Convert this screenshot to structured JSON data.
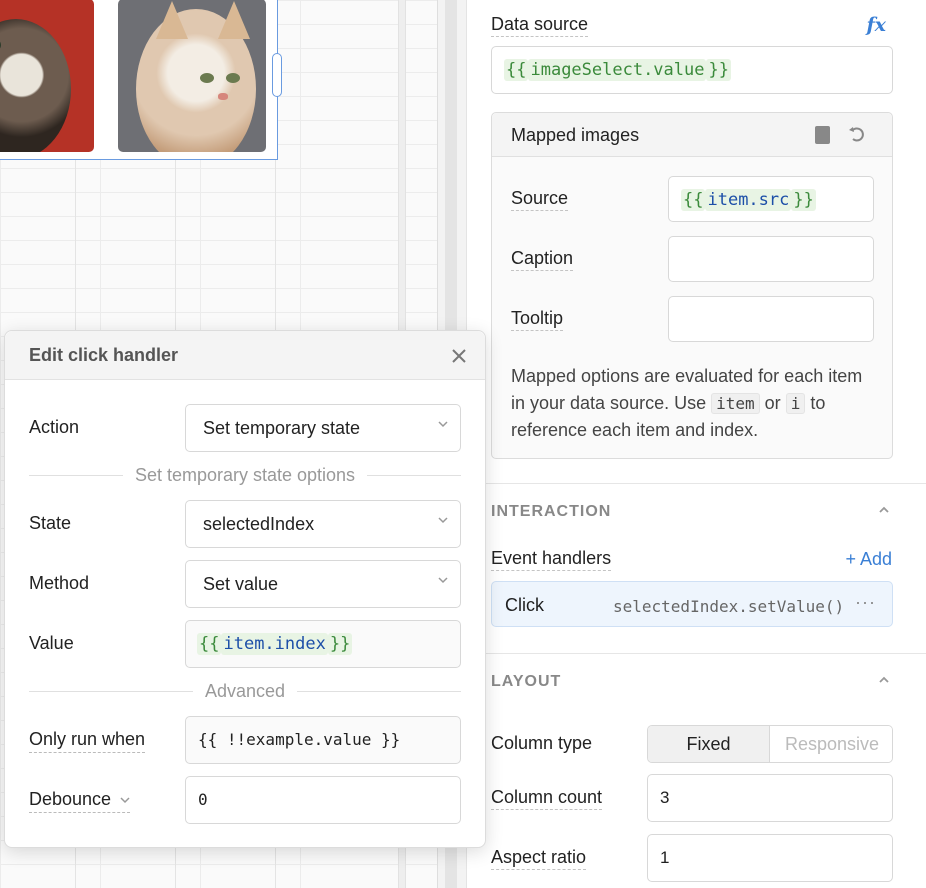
{
  "popup": {
    "title": "Edit click handler",
    "close_icon": "close-icon",
    "action_label": "Action",
    "action_value": "Set temporary state",
    "section_state_options": "Set temporary state options",
    "state_label": "State",
    "state_value": "selectedIndex",
    "method_label": "Method",
    "method_value": "Set value",
    "value_label": "Value",
    "value_open": "{{",
    "value_ident": "item.index",
    "value_close": "}}",
    "section_advanced": "Advanced",
    "only_run_when_label": "Only run when",
    "only_run_when_placeholder": "{{ !!example.value }}",
    "debounce_label": "Debounce",
    "debounce_value": "0"
  },
  "panel": {
    "data_source_label": "Data source",
    "fx_icon_text": "fx",
    "data_source_open": "{{",
    "data_source_ident": "imageSelect.value",
    "data_source_close": "}}",
    "mapped": {
      "title": "Mapped images",
      "source_label": "Source",
      "source_open": "{{",
      "source_ident": "item.src",
      "source_close": "}}",
      "caption_label": "Caption",
      "caption_value": "",
      "tooltip_label": "Tooltip",
      "tooltip_value": "",
      "help_1": "Mapped options are evaluated for each item in your data source. Use",
      "help_chip_1": "item",
      "help_or": "or",
      "help_chip_2": "i",
      "help_2": "to reference each item and index."
    },
    "interaction": {
      "title": "INTERACTION",
      "event_handlers_label": "Event handlers",
      "add_label": "+ Add",
      "handler_event": "Click",
      "handler_action": "selectedIndex.setValue()",
      "handler_more": "···"
    },
    "layout": {
      "title": "LAYOUT",
      "column_type_label": "Column type",
      "column_type_fixed": "Fixed",
      "column_type_responsive": "Responsive",
      "column_count_label": "Column count",
      "column_count_value": "3",
      "aspect_ratio_label": "Aspect ratio",
      "aspect_ratio_value": "1"
    }
  },
  "colors": {
    "accent": "#3a7fd5",
    "template_brace": "#3b8a3b",
    "template_ident": "#1d4fa8"
  }
}
